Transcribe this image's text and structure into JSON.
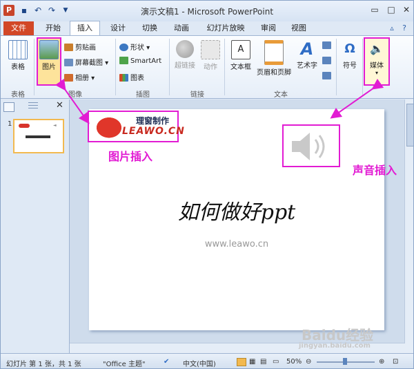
{
  "window": {
    "title": "演示文稿1 - Microsoft PowerPoint",
    "app_icon": "P"
  },
  "quick_access": {
    "save_icon": "save-icon",
    "undo_icon": "undo-icon",
    "redo_icon": "redo-icon",
    "customize": "▼"
  },
  "tabs": [
    {
      "label": "文件"
    },
    {
      "label": "开始"
    },
    {
      "label": "插入",
      "active": true
    },
    {
      "label": "设计"
    },
    {
      "label": "切换"
    },
    {
      "label": "动画"
    },
    {
      "label": "幻灯片放映"
    },
    {
      "label": "审阅"
    },
    {
      "label": "视图"
    }
  ],
  "ribbon": {
    "groups": {
      "table": {
        "label": "表格",
        "btn": "表格"
      },
      "images": {
        "label": "图像",
        "picture": "图片",
        "clipart": "剪贴画",
        "screenshot": "屏幕截图",
        "album": "相册"
      },
      "illustrations": {
        "label": "插图",
        "shapes": "形状",
        "smartart": "SmartArt",
        "chart": "图表"
      },
      "links": {
        "label": "链接",
        "hyperlink": "超链接",
        "action": "动作"
      },
      "text": {
        "label": "文本",
        "textbox": "文本框",
        "header": "页眉和页脚",
        "wordart": "艺术字"
      },
      "symbols": {
        "symbol": "符号"
      },
      "media": {
        "media": "媒体"
      }
    }
  },
  "slide": {
    "logo_top": "理窗制作",
    "logo_bottom": "LEAWO.CN",
    "title": "如何做好ppt",
    "subtitle": "www.leawo.cn"
  },
  "thumbnail": {
    "number": "1"
  },
  "annotations": {
    "picture_insert": "图片插入",
    "sound_insert": "声音插入"
  },
  "status": {
    "slide_info": "幻灯片 第 1 张，共 1 张",
    "theme": "\"Office 主题\"",
    "language": "中文(中国)",
    "zoom": "50%"
  },
  "watermark": {
    "brand": "Baidu经验",
    "url": "jingyan.baidu.com"
  },
  "colors": {
    "accent_annotation": "#e21bd3",
    "file_tab": "#d24726"
  }
}
